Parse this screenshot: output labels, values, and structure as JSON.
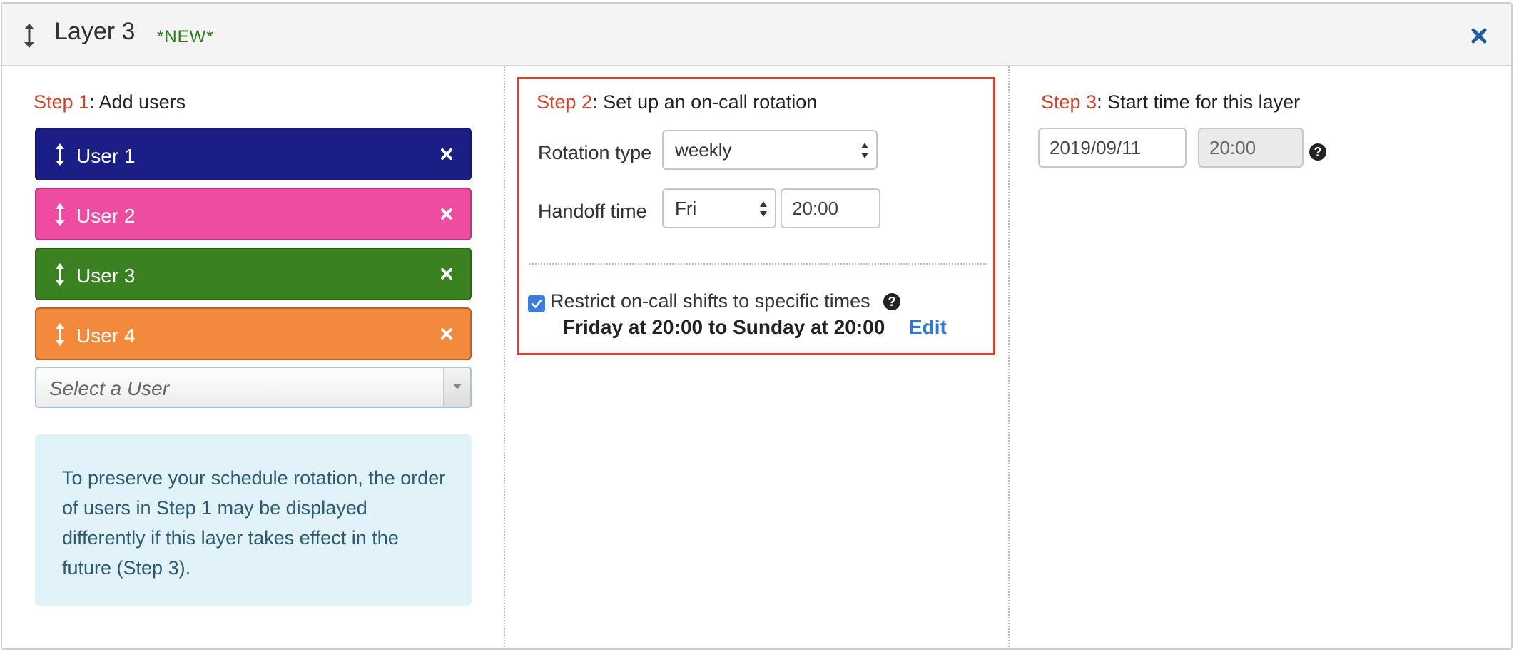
{
  "header": {
    "title": "Layer 3",
    "badge": "*NEW*"
  },
  "step1": {
    "step_label": "Step 1",
    "title": ": Add users",
    "users": [
      {
        "name": "User 1",
        "color": "#1b1f85"
      },
      {
        "name": "User 2",
        "color": "#ee4ca0"
      },
      {
        "name": "User 3",
        "color": "#3a8122"
      },
      {
        "name": "User 4",
        "color": "#f2893c"
      }
    ],
    "select_placeholder": "Select a User",
    "info_text": "To preserve your schedule rotation, the order of users in Step 1 may be displayed differently if this layer takes effect in the future (Step 3)."
  },
  "step2": {
    "step_label": "Step 2",
    "title": ": Set up an on-call rotation",
    "rotation_type_label": "Rotation type",
    "rotation_type_value": "weekly",
    "handoff_label": "Handoff time",
    "handoff_day": "Fri",
    "handoff_time": "20:00",
    "restrict_label": "Restrict on-call shifts to specific times",
    "restrict_checked": true,
    "shift_summary": "Friday at 20:00 to Sunday at 20:00",
    "edit_label": "Edit"
  },
  "step3": {
    "step_label": "Step 3",
    "title": ": Start time for this layer",
    "start_date": "2019/09/11",
    "start_time": "20:00"
  },
  "colors": {
    "step_accent": "#d43f2a",
    "highlight_border": "#d6432b",
    "link": "#2f78d6",
    "close": "#1d5fa0"
  }
}
